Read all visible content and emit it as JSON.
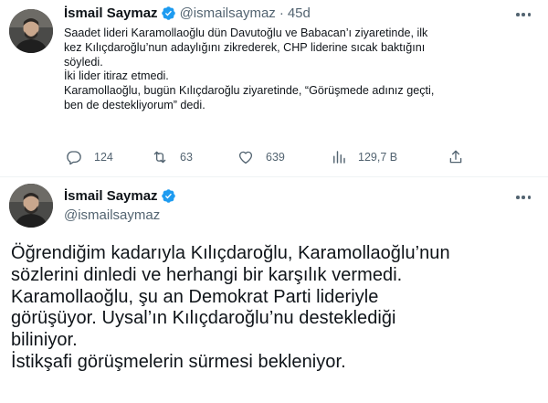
{
  "tweet1": {
    "display_name": "İsmail Saymaz",
    "handle": "@ismailsaymaz",
    "time": "45d",
    "body": [
      "Saadet lideri Karamollaoğlu dün Davutoğlu ve Babacan’ı ziyaretinde, ilk",
      "kez Kılıçdaroğlu’nun adaylığını zikrederek, CHP liderine sıcak baktığını",
      "söyledi.",
      "İki lider itiraz etmedi.",
      "Karamollaoğlu, bugün Kılıçdaroğlu ziyaretinde, “Görüşmede adınız geçti,",
      "ben de destekliyorum” dedi."
    ],
    "actions": {
      "replies": "124",
      "retweets": "63",
      "likes": "639",
      "views": "129,7 B"
    }
  },
  "tweet2": {
    "display_name": "İsmail Saymaz",
    "handle": "@ismailsaymaz",
    "body": [
      "Öğrendiğim kadarıyla Kılıçdaroğlu, Karamollaoğlu’nun",
      "sözlerini dinledi ve herhangi bir karşılık vermedi.",
      "Karamollaoğlu, şu an Demokrat Parti lideriyle",
      "görüşüyor. Uysal’ın Kılıçdaroğlu’nu desteklediği",
      "biliniyor.",
      "İstikşafi görüşmelerin sürmesi bekleniyor."
    ]
  },
  "colors": {
    "text": "#0f1419",
    "secondary": "#536471",
    "verified": "#1d9bf0",
    "divider": "#eff3f4"
  }
}
